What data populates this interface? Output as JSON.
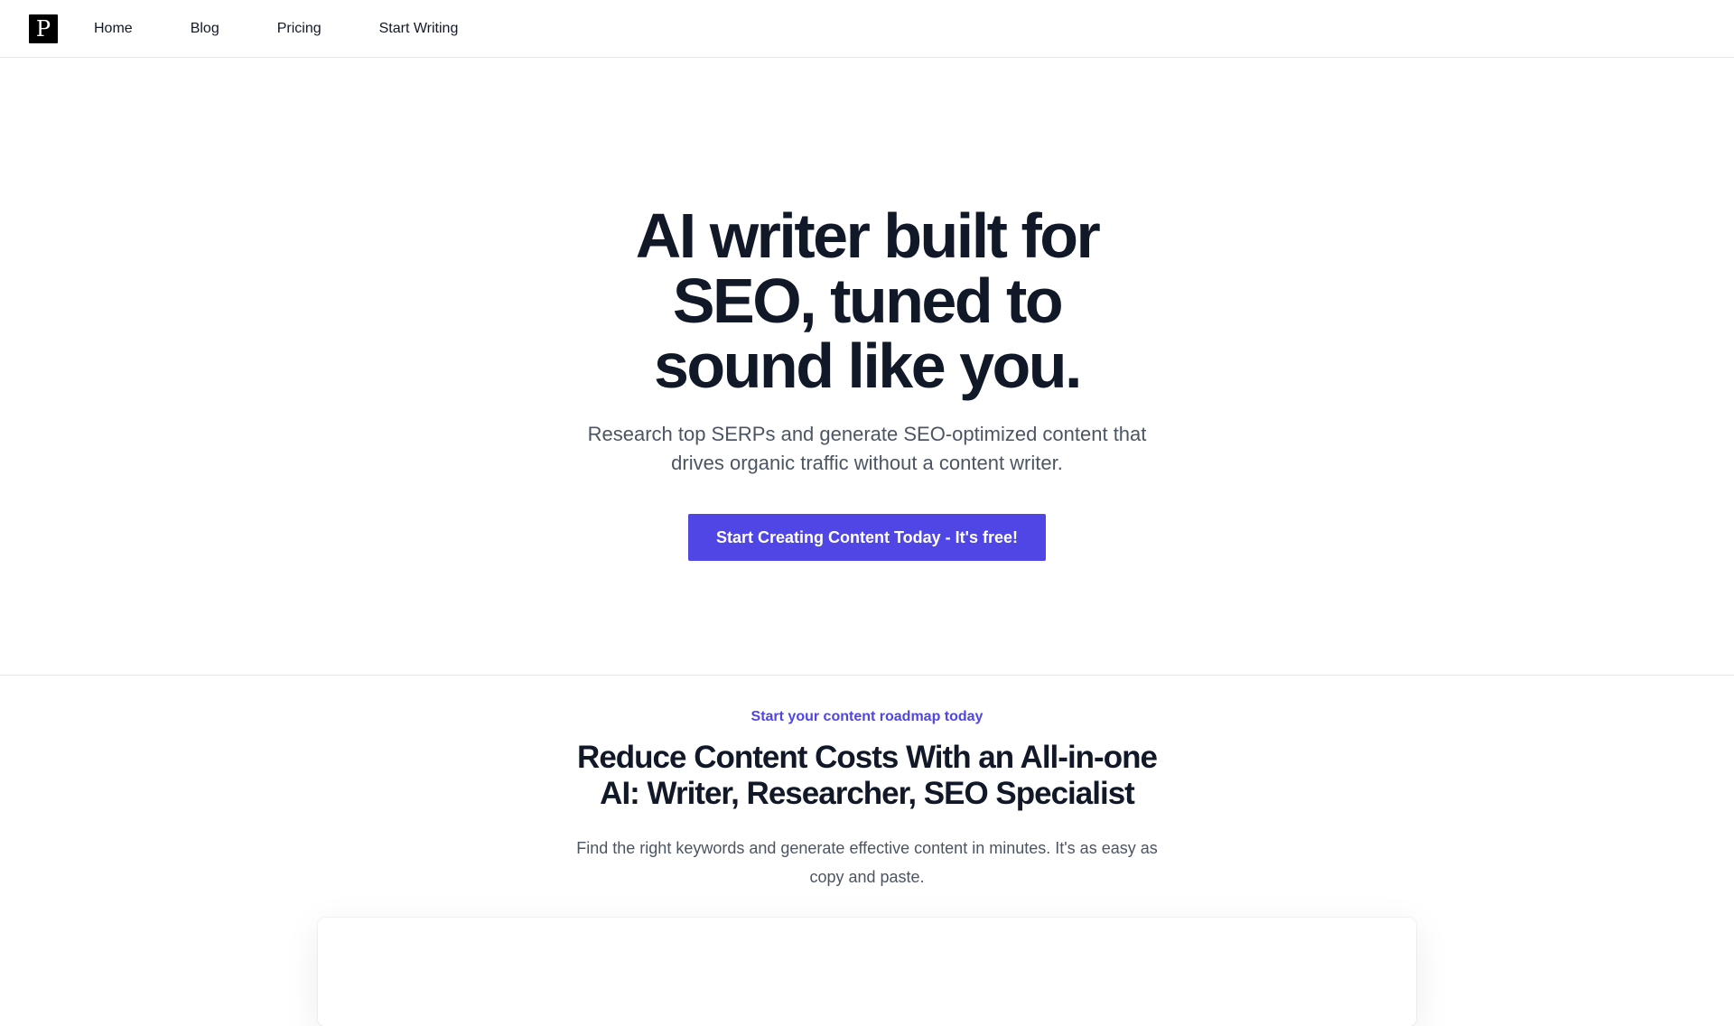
{
  "brand": {
    "logo_letter": "P"
  },
  "nav": {
    "items": [
      {
        "label": "Home"
      },
      {
        "label": "Blog"
      },
      {
        "label": "Pricing"
      },
      {
        "label": "Start Writing"
      }
    ]
  },
  "hero": {
    "title": "AI writer built for SEO, tuned to sound like you.",
    "subtitle": "Research top SERPs and generate SEO-optimized content that drives organic traffic without a content writer.",
    "cta_label": "Start Creating Content Today - It's free!"
  },
  "features": {
    "eyebrow": "Start your content roadmap today",
    "title": "Reduce Content Costs With an All-in-one AI: Writer, Researcher, SEO Specialist",
    "subtitle": "Find the right keywords and generate effective content in minutes. It's as easy as copy and paste."
  },
  "colors": {
    "accent": "#4f46e5",
    "text_dark": "#111827",
    "text_muted": "#4b5563",
    "border": "#e5e7eb"
  }
}
